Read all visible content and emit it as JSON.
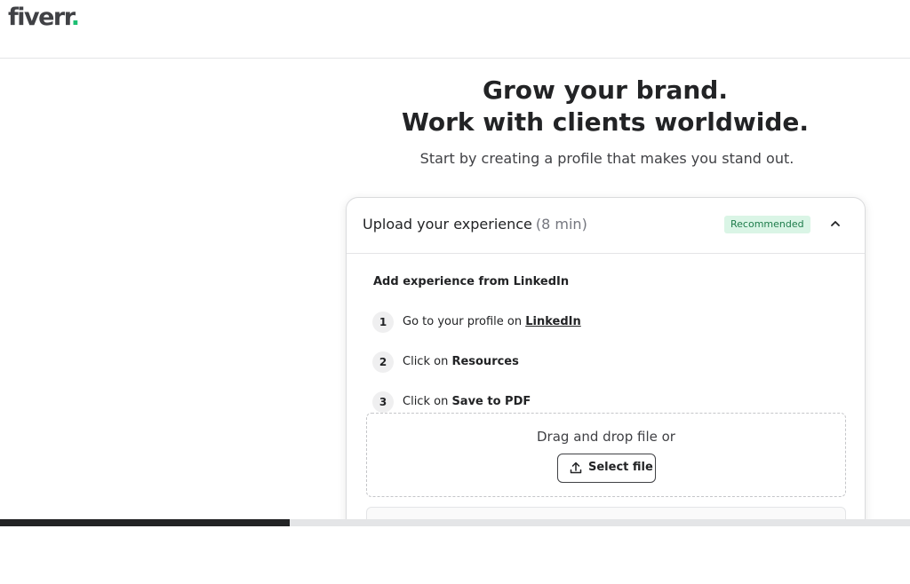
{
  "brand": {
    "logo_text": "fiverr",
    "logo_dot": ".",
    "accent_color": "#1dbf73"
  },
  "hero": {
    "title_line1": "Grow your brand.",
    "title_line2": "Work with clients worldwide.",
    "subtitle": "Start by creating a profile that makes you stand out."
  },
  "card": {
    "title": "Upload your experience",
    "duration": "(8 min)",
    "badge": "Recommended",
    "collapse_icon": "chevron-up-icon",
    "section_title": "Add experience from LinkedIn",
    "steps": [
      {
        "number": "1",
        "text": "Go to your profile on ",
        "emphasis": "LinkedIn"
      },
      {
        "number": "2",
        "text": "Click on ",
        "emphasis": "Resources"
      },
      {
        "number": "3",
        "text": "Click on ",
        "emphasis": "Save to PDF"
      }
    ],
    "dropzone": {
      "text": "Drag and drop file or",
      "button_label": "Select file",
      "button_icon": "upload-icon"
    }
  },
  "progress": {
    "percent": 31.8
  }
}
